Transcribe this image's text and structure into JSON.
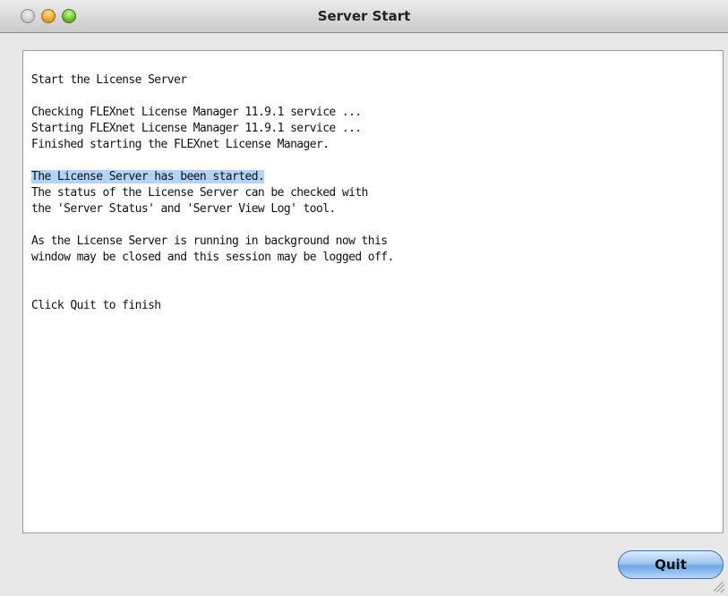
{
  "window": {
    "title": "Server Start"
  },
  "log": {
    "lines": [
      {
        "text": "Start the License Server",
        "selected": false
      },
      {
        "text": "",
        "selected": false
      },
      {
        "text": "Checking FLEXnet License Manager 11.9.1 service ...",
        "selected": false
      },
      {
        "text": "Starting FLEXnet License Manager 11.9.1 service ...",
        "selected": false
      },
      {
        "text": "Finished starting the FLEXnet License Manager.",
        "selected": false
      },
      {
        "text": "",
        "selected": false
      },
      {
        "text": "The License Server has been started.",
        "selected": true
      },
      {
        "text": "The status of the License Server can be checked with",
        "selected": false
      },
      {
        "text": "the 'Server Status' and 'Server View Log' tool.",
        "selected": false
      },
      {
        "text": "",
        "selected": false
      },
      {
        "text": "As the License Server is running in background now this",
        "selected": false
      },
      {
        "text": "window may be closed and this session may be logged off.",
        "selected": false
      },
      {
        "text": "",
        "selected": false
      },
      {
        "text": "",
        "selected": false
      },
      {
        "text": "Click Quit to finish",
        "selected": false
      }
    ]
  },
  "buttons": {
    "quit_label": "Quit"
  },
  "colors": {
    "selection": "#b3d3f7",
    "button_accent": "#6ea7e6"
  }
}
